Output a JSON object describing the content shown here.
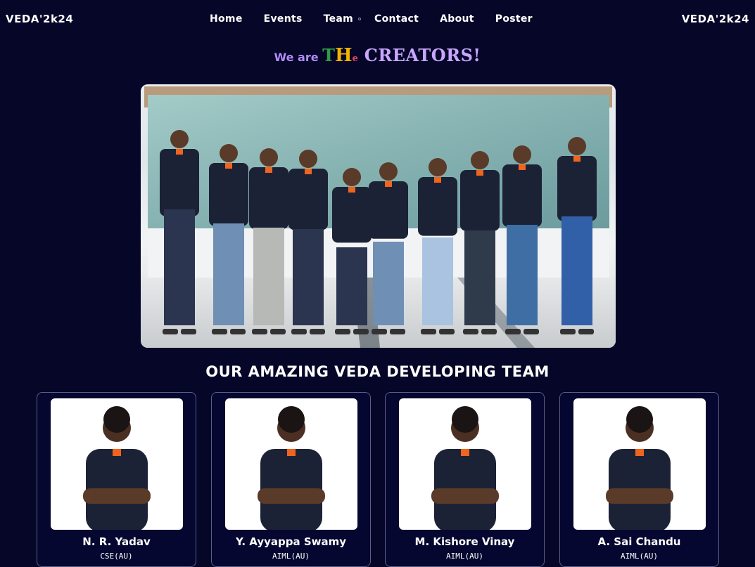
{
  "nav": {
    "brand_left": "VEDA'2k24",
    "brand_right": "VEDA'2k24",
    "links": [
      "Home",
      "Events",
      "Team",
      "Contact",
      "About",
      "Poster"
    ]
  },
  "hero": {
    "prefix": "We are ",
    "the_t": "T",
    "the_h": "H",
    "the_e": "e",
    "creators": " CREATORS!"
  },
  "section": {
    "heading": "OUR AMAZING VEDA DEVELOPING TEAM"
  },
  "team": [
    {
      "name": "N. R. Yadav",
      "dept": "CSE(AU)"
    },
    {
      "name": "Y. Ayyappa Swamy",
      "dept": "AIML(AU)"
    },
    {
      "name": "M. Kishore Vinay",
      "dept": "AIML(AU)"
    },
    {
      "name": "A. Sai Chandu",
      "dept": "AIML(AU)"
    }
  ],
  "colors": {
    "background": "#050628",
    "accent_purple": "#b48cff",
    "card_border": "#5c5f86",
    "shirt": "#1c2236",
    "shirt_collar": "#f0641e"
  }
}
